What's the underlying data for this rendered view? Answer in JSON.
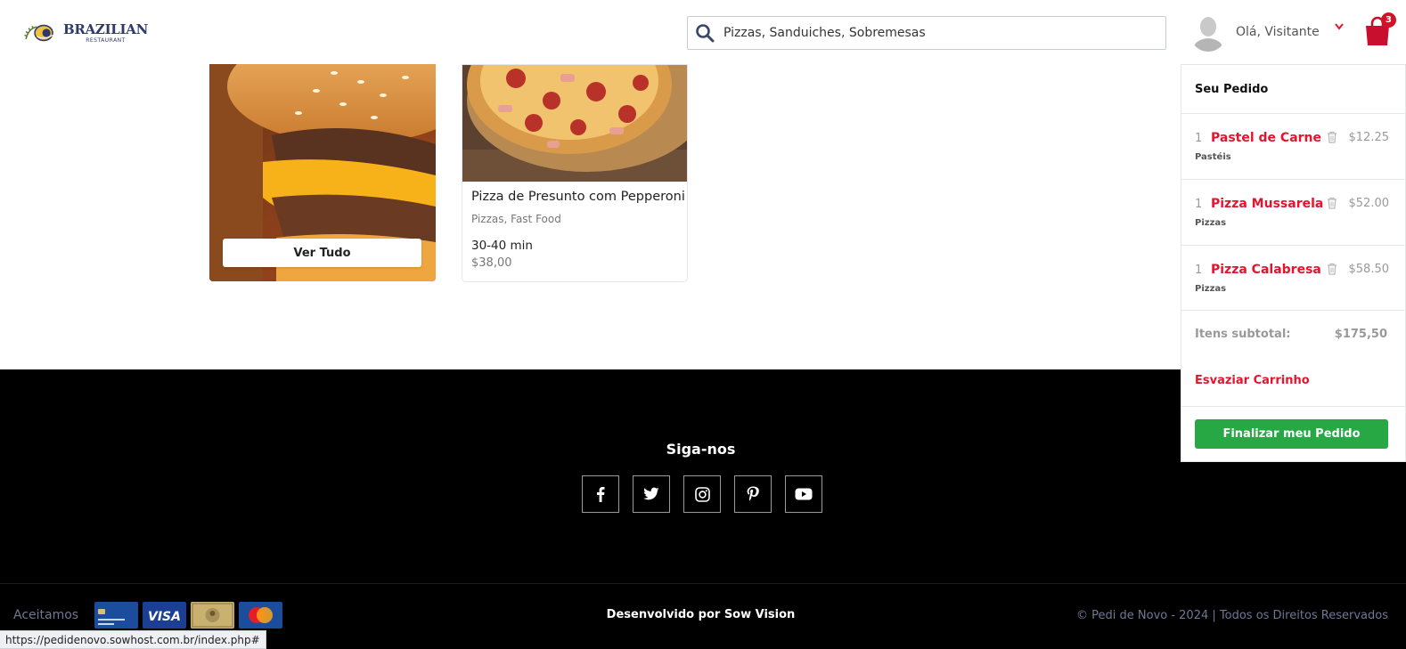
{
  "header": {
    "logo_title": "BRAZILIAN",
    "logo_subtitle": "RESTAURANT",
    "search_value": "Pizzas, Sanduiches, Sobremesas",
    "greeting": "Olá, Visitante",
    "cart_count": "3"
  },
  "products": {
    "burger_card": {
      "button_label": "Ver Tudo"
    },
    "pizza_card": {
      "name": "Pizza de Presunto com Pepperoni",
      "category": "Pizzas, Fast Food",
      "time": "30-40 min",
      "price": "$38,00"
    }
  },
  "cart": {
    "title": "Seu Pedido",
    "items": [
      {
        "qty": "1",
        "name": "Pastel de Carne",
        "price": "$12.25",
        "category": "Pastéis"
      },
      {
        "qty": "1",
        "name": "Pizza Mussarela",
        "price": "$52.00",
        "category": "Pizzas"
      },
      {
        "qty": "1",
        "name": "Pizza Calabresa",
        "price": "$58.50",
        "category": "Pizzas"
      }
    ],
    "subtotal_label": "Itens subtotal:",
    "subtotal_value": "$175,50",
    "empty_label": "Esvaziar Carrinho",
    "finalize_label": "Finalizar meu Pedido"
  },
  "footer": {
    "follow_title": "Siga-nos",
    "socials": [
      "facebook-icon",
      "twitter-icon",
      "instagram-icon",
      "pinterest-icon",
      "youtube-icon"
    ],
    "accept_label": "Aceitamos",
    "payment_cards": [
      "credit-card",
      "VISA",
      "amex",
      "MasterCard"
    ],
    "visa_label": "VISA",
    "developer": "Desenvolvido por Sow Vision",
    "copyright": "© Pedi de Novo - 2024 | Todos os Direitos Reservados"
  },
  "status_bar": {
    "url": "https://pedidenovo.sowhost.com.br/index.php#"
  },
  "colors": {
    "accent_red": "#e3152e",
    "button_green": "#28a745",
    "footer_bg": "#000000",
    "badge_red": "#d3122a"
  }
}
